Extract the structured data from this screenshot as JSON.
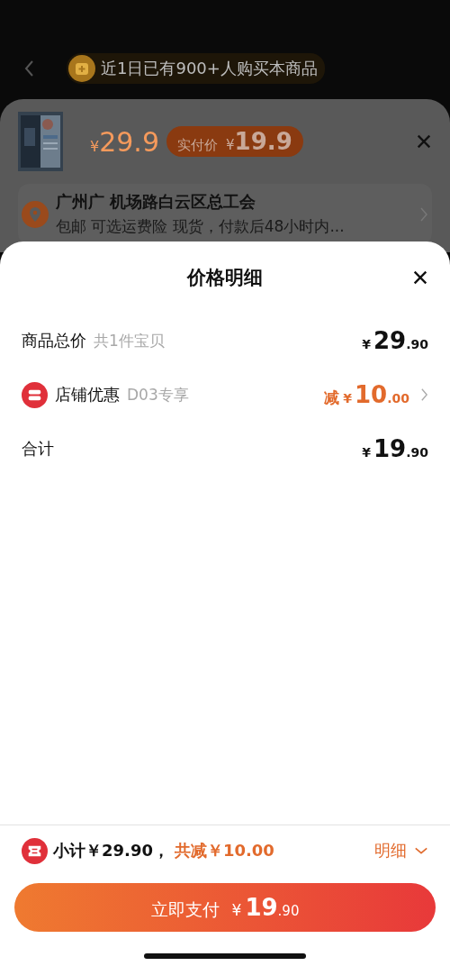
{
  "header": {
    "badge": "近1日已有900+人购买本商品"
  },
  "order_sheet": {
    "price": "29.9",
    "currency": "¥",
    "pay_pill": {
      "label": "实付价",
      "currency": "¥",
      "amount": "19.9"
    },
    "address": {
      "line": "广州广 机场路白云区总工会",
      "detail": "包邮  可选运费险  现货，付款后48小时内..."
    }
  },
  "price_detail": {
    "title": "价格明细",
    "rows": [
      {
        "kind": "plain",
        "label": "商品总价",
        "note": "共1件宝贝",
        "prefix": "",
        "currency": "¥",
        "integer": "29",
        "decimal": ".90"
      },
      {
        "kind": "discount",
        "label": "店铺优惠",
        "note": "D03专享",
        "prefix": "减",
        "currency": "¥",
        "integer": "10",
        "decimal": ".00"
      },
      {
        "kind": "plain",
        "label": "合计",
        "note": "",
        "prefix": "",
        "currency": "¥",
        "integer": "19",
        "decimal": ".90"
      }
    ]
  },
  "summary": {
    "subtotal": "小计￥29.90，",
    "reduction": "共减￥10.00",
    "toggle": "明细"
  },
  "pay_button": {
    "label": "立即支付",
    "currency": "¥",
    "integer": "19",
    "decimal": ".90"
  }
}
